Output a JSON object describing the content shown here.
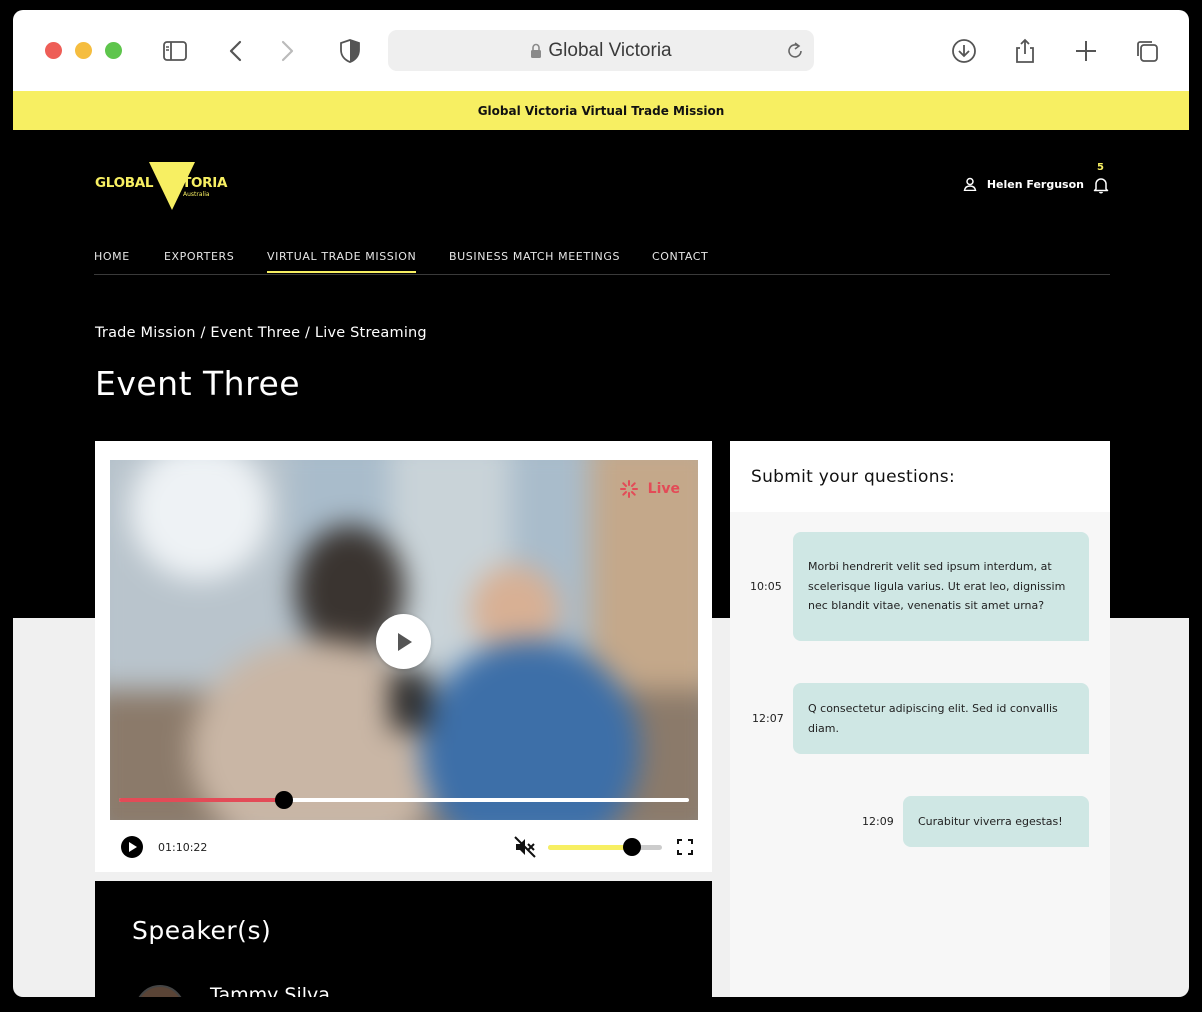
{
  "browser": {
    "url_text": "Global Victoria"
  },
  "banner": {
    "text": "Global Victoria Virtual Trade Mission"
  },
  "header": {
    "logo_text": "GLOBAL VICTORIA",
    "logo_sub": "Australia",
    "user_name": "Helen Ferguson",
    "notification_count": "5"
  },
  "nav": {
    "items": [
      {
        "label": "HOME"
      },
      {
        "label": "EXPORTERS"
      },
      {
        "label": "VIRTUAL TRADE MISSION"
      },
      {
        "label": "BUSINESS MATCH MEETINGS"
      },
      {
        "label": "CONTACT"
      }
    ],
    "active_index": 2
  },
  "breadcrumb": "Trade Mission / Event Three / Live Streaming",
  "page_title": "Event Three",
  "video": {
    "live_label": "Live",
    "current_time": "01:10:22",
    "progress": 0.29,
    "volume": 0.74,
    "muted": true
  },
  "speakers": {
    "title": "Speaker(s)",
    "items": [
      {
        "name": "Tammy Silva"
      }
    ]
  },
  "questions": {
    "title": "Submit your questions:",
    "messages": [
      {
        "time": "10:05",
        "text": "Morbi hendrerit velit sed ipsum interdum, at scelerisque ligula varius. Ut erat leo, dignissim nec blandit vitae, venenatis sit amet urna?"
      },
      {
        "time": "12:07",
        "text": "Q consectetur adipiscing elit. Sed id convallis diam."
      },
      {
        "time": "12:09",
        "text": "Curabitur viverra egestas!"
      }
    ]
  },
  "colors": {
    "accent_yellow": "#f7ef62",
    "live_red": "#e34b57",
    "bubble": "#cfe7e4"
  }
}
